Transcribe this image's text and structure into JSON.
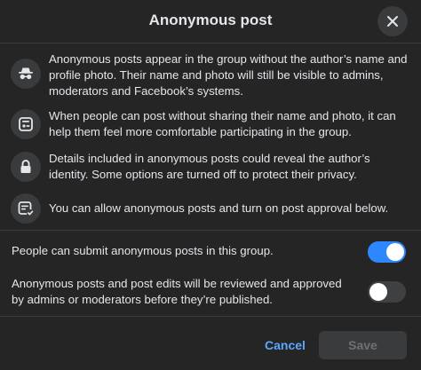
{
  "dialog": {
    "title": "Anonymous post",
    "close_icon": "close-icon"
  },
  "info_items": [
    {
      "icon": "incognito-icon",
      "text": "Anonymous posts appear in the group without the author’s name and profile photo. Their name and photo will still be visible to admins, moderators and Facebook’s systems."
    },
    {
      "icon": "post-card-icon",
      "text": "When people can post without sharing their name and photo, it can help them feel more comfortable participating in the group."
    },
    {
      "icon": "lock-icon",
      "text": "Details included in anonymous posts could reveal the author’s identity. Some options are turned off to protect their privacy."
    },
    {
      "icon": "approved-post-icon",
      "text": "You can allow anonymous posts and turn on post approval below."
    }
  ],
  "settings": [
    {
      "label": "People can submit anonymous posts in this group.",
      "enabled": true
    },
    {
      "label": "Anonymous posts and post edits will be reviewed and approved by admins or moderators before they’re published.",
      "enabled": false
    }
  ],
  "footer": {
    "cancel_label": "Cancel",
    "save_label": "Save"
  },
  "colors": {
    "background": "#252526",
    "accent": "#2d88ff",
    "link": "#5aa7ff",
    "icon_circle": "#3a3b3c"
  }
}
